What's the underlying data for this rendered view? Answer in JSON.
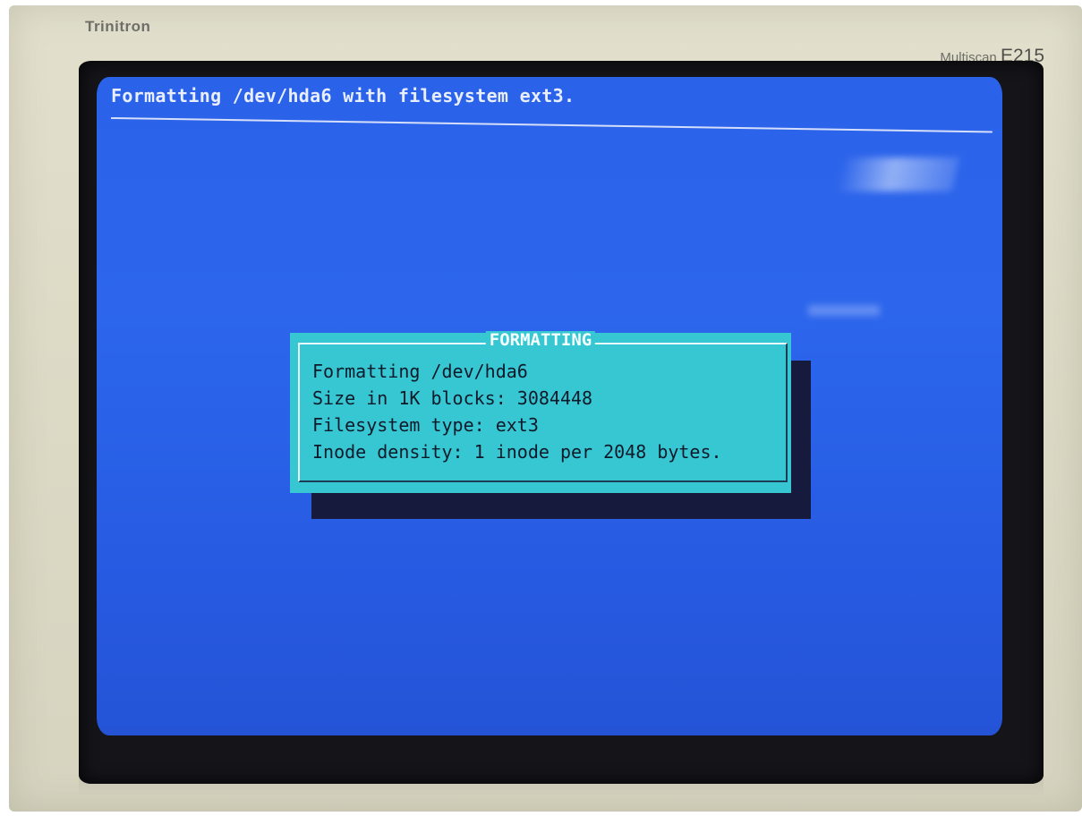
{
  "monitor": {
    "brand": "Trinitron",
    "series": "Multiscan",
    "model": "E215"
  },
  "screen": {
    "header": "Formatting /dev/hda6 with filesystem ext3."
  },
  "dialog": {
    "title": "FORMATTING",
    "lines": [
      "Formatting /dev/hda6",
      "Size in 1K blocks: 3084448",
      "Filesystem type: ext3",
      "Inode density: 1 inode per 2048 bytes."
    ]
  },
  "colors": {
    "screen_background": "#2a62e9",
    "dialog_background": "#37c7d2",
    "dialog_shadow": "#161a3c",
    "header_text": "#e9eeff",
    "dialog_text": "#0e1a2a",
    "bezel": "#dddbc6"
  }
}
